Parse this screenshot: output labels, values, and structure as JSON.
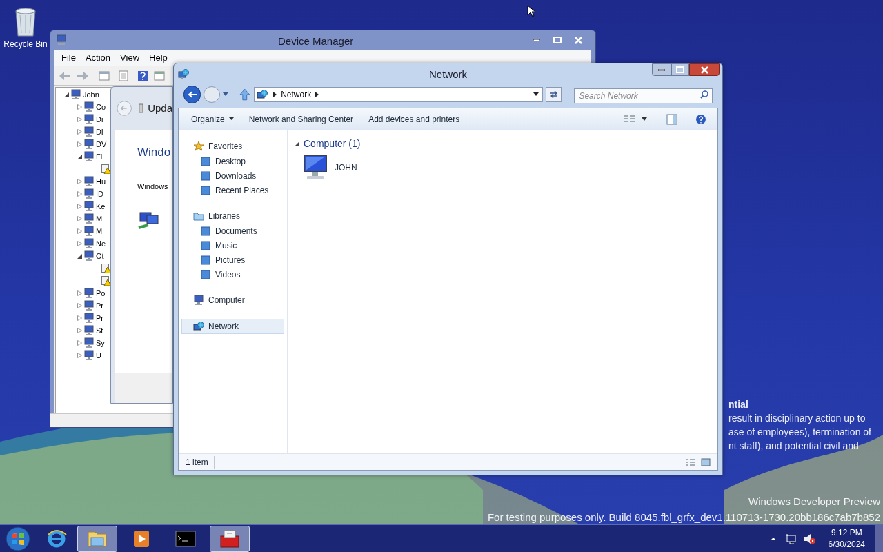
{
  "desktop": {
    "icons": [
      {
        "label": "Recycle Bin"
      }
    ],
    "background_text": [
      "ntial",
      "result in disciplinary action up to",
      "ase of employees), termination of",
      "nt staff), and potential civil and"
    ],
    "watermark": [
      "Windows Developer Preview",
      "For testing purposes only. Build 8045.fbl_grfx_dev1.110713-1730.20bb186c7ab7b852"
    ]
  },
  "device_manager": {
    "title": "Device Manager",
    "menu": [
      "File",
      "Action",
      "View",
      "Help"
    ],
    "tree": {
      "label": "John",
      "expanded": true,
      "children": [
        {
          "label": "Co",
          "expanded": false
        },
        {
          "label": "Di",
          "expanded": false
        },
        {
          "label": "Di",
          "expanded": false
        },
        {
          "label": "DV",
          "expanded": false
        },
        {
          "label": "Fl",
          "expanded": true,
          "children": [
            {
              "warning": true
            }
          ]
        },
        {
          "label": "Hu",
          "expanded": false
        },
        {
          "label": "ID",
          "expanded": false
        },
        {
          "label": "Ke",
          "expanded": false
        },
        {
          "label": "M",
          "expanded": false
        },
        {
          "label": "M",
          "expanded": false
        },
        {
          "label": "Ne",
          "expanded": false
        },
        {
          "label": "Ot",
          "expanded": true,
          "children": [
            {
              "warning": true
            },
            {
              "warning": true
            }
          ]
        },
        {
          "label": "Po",
          "expanded": false
        },
        {
          "label": "Pr",
          "expanded": false
        },
        {
          "label": "Pr",
          "expanded": false
        },
        {
          "label": "St",
          "expanded": false
        },
        {
          "label": "Sy",
          "expanded": false
        },
        {
          "label": "U",
          "expanded": false
        }
      ]
    }
  },
  "update_dialog": {
    "title": "Upda",
    "heading": "Windo",
    "text": "Windows"
  },
  "explorer": {
    "title": "Network",
    "address": [
      "Network"
    ],
    "search": {
      "placeholder": "Search Network"
    },
    "commands": [
      "Organize",
      "Network and Sharing Center",
      "Add devices and printers"
    ],
    "nav": [
      {
        "label": "Favorites",
        "selected": false,
        "children": [
          {
            "label": "Desktop",
            "selected": false
          },
          {
            "label": "Downloads",
            "selected": false
          },
          {
            "label": "Recent Places",
            "selected": false
          }
        ]
      },
      {
        "label": "Libraries",
        "selected": false,
        "children": [
          {
            "label": "Documents",
            "selected": false
          },
          {
            "label": "Music",
            "selected": false
          },
          {
            "label": "Pictures",
            "selected": false
          },
          {
            "label": "Videos",
            "selected": false
          }
        ]
      },
      {
        "label": "Computer",
        "selected": false
      },
      {
        "label": "Network",
        "selected": true
      }
    ],
    "groups": [
      {
        "title": "Computer (1)",
        "expanded": true,
        "items": [
          {
            "label": "JOHN"
          }
        ]
      }
    ],
    "status": "1 item"
  },
  "taskbar": {
    "buttons": [
      {
        "kind": "ie",
        "active": false
      },
      {
        "kind": "explorer",
        "active": true
      },
      {
        "kind": "media",
        "active": false
      },
      {
        "kind": "cmd",
        "active": false
      },
      {
        "kind": "toolbox",
        "active": true
      }
    ],
    "time": "9:12 PM",
    "date": "6/30/2024"
  }
}
